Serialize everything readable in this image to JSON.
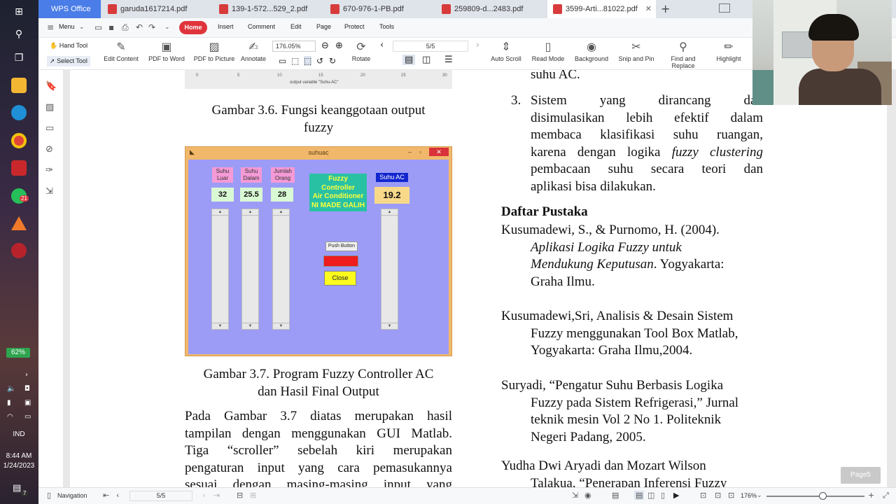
{
  "taskbar": {
    "battery": "62%",
    "language": "IND",
    "time": "8:44 AM",
    "date": "1/24/2023",
    "whatsapp_badge": "21",
    "notification_badge": "7"
  },
  "tabs": [
    {
      "label": "WPS Office"
    },
    {
      "label": "garuda1617214.pdf"
    },
    {
      "label": "139-1-572...529_2.pdf"
    },
    {
      "label": "670-976-1-PB.pdf"
    },
    {
      "label": "259809-d...2483.pdf"
    },
    {
      "label": "3599-Arti...81022.pdf"
    }
  ],
  "menu": {
    "menu_label": "Menu",
    "items": [
      "Home",
      "Insert",
      "Comment",
      "Edit",
      "Page",
      "Protect",
      "Tools"
    ]
  },
  "toolbar": {
    "hand_tool": "Hand Tool",
    "select_tool": "Select Tool",
    "edit_content": "Edit Content",
    "pdf_to_word": "PDF to Word",
    "pdf_to_picture": "PDF to Picture",
    "annotate": "Annotate",
    "zoom": "176.05%",
    "rotate": "Rotate",
    "page": "5/5",
    "auto_scroll": "Auto Scroll",
    "read_mode": "Read Mode",
    "background": "Background",
    "snip_and_pin": "Snip and Pin",
    "find_and_replace": "Find and Replace",
    "highlight": "Highlight"
  },
  "doc": {
    "chart_ticks": [
      "0",
      "5",
      "10",
      "15",
      "20",
      "25",
      "30"
    ],
    "chart_xlabel": "output variable \"Suhu-AC\"",
    "caption_36_l1": "Gambar 3.6. Fungsi keanggotaan output",
    "caption_36_l2": "fuzzy",
    "caption_37_l1": "Gambar 3.7. Program Fuzzy Controller AC",
    "caption_37_l2": "dan Hasil Final Output",
    "para_left": [
      "Pada Gambar 3.7 diatas merupakan hasil",
      "tampilan dengan menggunakan GUI Matlab.",
      "Tiga “scroller” sebelah kiri merupakan",
      "pengaturan input yang cara pemasukannya",
      "sesuai dengan masing-masing input yang"
    ],
    "right_top": "suhu AC.",
    "list_num": "3.",
    "list_lines": [
      "Sistem yang dirancang dan",
      "disimulasikan lebih efektif dalam",
      "membaca klasifikasi suhu ruangan,"
    ],
    "list_line4_a": "karena dengan logika ",
    "list_line4_b": "fuzzy clustering",
    "list_line5": "pembacaan suhu secara teori dan",
    "list_line6": "aplikasi bisa dilakukan.",
    "heading": "Daftar Pustaka",
    "ref1_l1": "Kusumadewi, S., & Purnomo, H. (2004).",
    "ref1_l2": "Aplikasi Logika Fuzzy untuk",
    "ref1_l3a": "Mendukung Keputusan",
    "ref1_l3b": ". Yogyakarta:",
    "ref1_l4": "Graha Ilmu.",
    "ref2_l1": "Kusumadewi,Sri, Analisis & Desain Sistem",
    "ref2_l2": "Fuzzy menggunakan Tool Box Matlab,",
    "ref2_l3": "Yogyakarta: Graha Ilmu,2004.",
    "ref3_l1": "Suryadi, “Pengatur Suhu Berbasis Logika",
    "ref3_l2": "Fuzzy pada Sistem Refrigerasi,” Jurnal",
    "ref3_l3": "teknik mesin Vol 2 No 1. Politeknik",
    "ref3_l4": "Negeri Padang, 2005.",
    "ref4_l1": "Yudha Dwi Aryadi dan Mozart Wilson",
    "ref4_l2": "Talakua, “Penerapan Inferensi Fuzzy"
  },
  "matlab_gui": {
    "title": "suhuac",
    "labels": [
      "Suhu Luar",
      "Suhu Dalam",
      "Jumlah Orang"
    ],
    "values": [
      "32",
      "25.5",
      "28"
    ],
    "fc_lines": [
      "Fuzzy",
      "Controller",
      "Air Conditioner",
      "NI MADE GALIH"
    ],
    "ac_label": "Suhu AC",
    "ac_value": "19.2",
    "push_button": "Push Button",
    "close": "Close"
  },
  "statusbar": {
    "navigation": "Navigation",
    "page": "5/5",
    "zoom": "176%"
  },
  "page_indicator": "Page5"
}
